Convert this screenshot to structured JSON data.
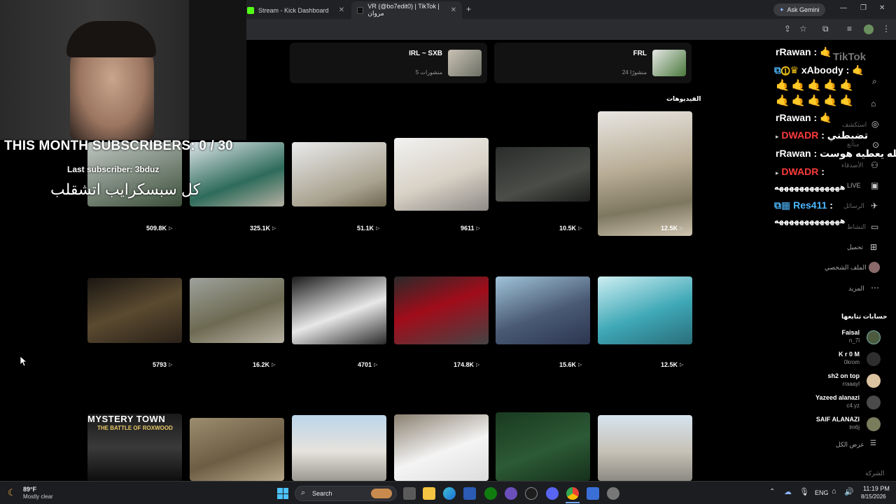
{
  "browser": {
    "tabs": [
      {
        "title": "Stream - Kick Dashboard",
        "close": "✕"
      },
      {
        "title": "VR (@bo7edit0) | TikTok | مروان",
        "close": "✕"
      }
    ],
    "new_tab": "+",
    "ask_gemini": "Ask Gemini",
    "window_controls": {
      "minimize": "—",
      "maximize": "❐",
      "close": "✕"
    }
  },
  "playlists": [
    {
      "title": "IRL ~ SXB",
      "count": "5 منشورات"
    },
    {
      "title": "FRL",
      "count": "24 منشورًا"
    }
  ],
  "videos_section_title": "الفيديوهات",
  "video_rows": [
    [
      "509.8K",
      "325.1K",
      "51.1K",
      "9611",
      "10.5K",
      "12.5K"
    ],
    [
      "5793",
      "16.2K",
      "4701",
      "174.8K",
      "15.6K",
      "12.5K"
    ]
  ],
  "overlay": {
    "subscribers": "THIS MONTH SUBSCRIBERS: 0 / 30",
    "last_subscriber": "Last subscriber: 3bduz",
    "arabic_caption": "كل سبسكرايب اتشقلب"
  },
  "thumb_captions": {
    "row3_1": "MYSTERY TOWN",
    "row3_1_sub": "THE BATTLE OF ROXWOOD"
  },
  "chat": [
    {
      "user": "rRawan",
      "sep": ":",
      "msg": ""
    },
    {
      "user": "xAboody",
      "sep": ":",
      "msg": ""
    },
    {
      "user": "rRawan",
      "sep": ":",
      "msg": ""
    },
    {
      "user": "DWADR",
      "sep": ":",
      "msg": "تضبطني"
    },
    {
      "user": "rRawan",
      "sep": ":",
      "msg": "خله يعطيه هوست"
    },
    {
      "user": "DWADR",
      "sep": ":",
      "msg": ""
    },
    {
      "user": "",
      "sep": "",
      "msg": "هههههههههههههه"
    },
    {
      "user": "Res411",
      "sep": ":",
      "msg": ""
    },
    {
      "user": "",
      "sep": "",
      "msg": "هههههههههههههه"
    }
  ],
  "tiktok_logo": "TikTok",
  "sidebar_nav": [
    {
      "label": "استكشف",
      "icon": "compass-icon"
    },
    {
      "label": "متابَع",
      "icon": "following-icon"
    },
    {
      "label": "الأصدقاء",
      "icon": "friends-icon"
    },
    {
      "label": "LIVE",
      "icon": "live-icon"
    },
    {
      "label": "الرسائل",
      "icon": "messages-icon"
    },
    {
      "label": "النشاط",
      "icon": "activity-icon"
    },
    {
      "label": "تحميل",
      "icon": "upload-icon"
    },
    {
      "label": "الملف الشخصي",
      "icon": "profile-icon"
    },
    {
      "label": "المزيد",
      "icon": "more-icon"
    }
  ],
  "following_title": "حسابات تتابعها",
  "following": [
    {
      "name": "Faisal",
      "id": "n_7l"
    },
    {
      "name": "K r 0 M",
      "id": "0krom"
    },
    {
      "name": "sh2 on top",
      "id": "rraaayl"
    },
    {
      "name": "Yazeed alanazi",
      "id": "c4.yz"
    },
    {
      "name": "SAIF ALANAZI",
      "id": "lm6j"
    }
  ],
  "see_all": "عرض الكل",
  "company": "الشركة",
  "taskbar": {
    "weather_temp": "89°F",
    "weather_desc": "Mostly clear",
    "search": "Search",
    "lang": "ENG",
    "time": "11:19 PM",
    "date": "8/15/2026"
  },
  "colors": {
    "accent_red": "#ff3b3b",
    "accent_blue": "#4db8ff",
    "tiktok_bg": "#000000"
  }
}
